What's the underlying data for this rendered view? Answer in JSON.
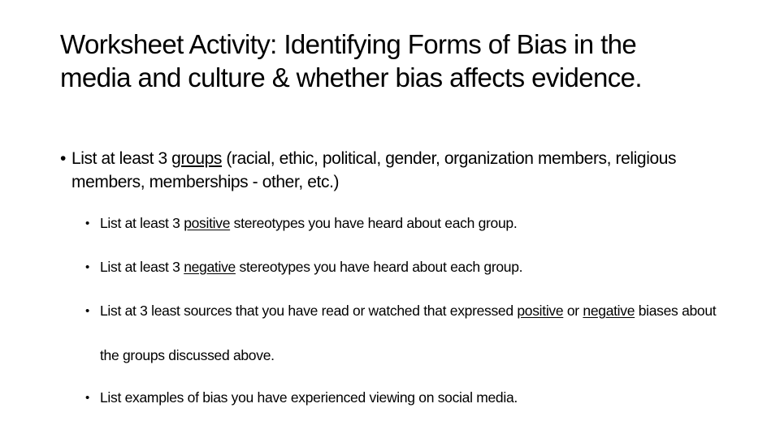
{
  "slide": {
    "title": "Worksheet Activity: Identifying Forms of Bias in the media and culture & whether bias affects evidence.",
    "bullet_glyph": "•",
    "level1": [
      {
        "segments": [
          {
            "text": "List at least 3 ",
            "underline": false
          },
          {
            "text": "groups",
            "underline": true
          },
          {
            "text": " (racial, ethic, political, gender, organization members, religious members, memberships - other, etc.)",
            "underline": false
          }
        ]
      }
    ],
    "level2": [
      {
        "segments": [
          {
            "text": "List at least 3 ",
            "underline": false
          },
          {
            "text": "positive",
            "underline": true
          },
          {
            "text": " stereotypes you have heard about each group.",
            "underline": false
          }
        ]
      },
      {
        "segments": [
          {
            "text": "List at least 3 ",
            "underline": false
          },
          {
            "text": "negative",
            "underline": true
          },
          {
            "text": " stereotypes you have heard about each group.",
            "underline": false
          }
        ]
      },
      {
        "segments": [
          {
            "text": "List at 3 least sources that you have read or watched that expressed ",
            "underline": false
          },
          {
            "text": "positive",
            "underline": true
          },
          {
            "text": " or ",
            "underline": false
          },
          {
            "text": "negative",
            "underline": true
          },
          {
            "text": " biases about the groups discussed above.",
            "underline": false
          }
        ]
      },
      {
        "segments": [
          {
            "text": "List examples of bias you have experienced viewing on social media.",
            "underline": false
          }
        ]
      }
    ]
  }
}
